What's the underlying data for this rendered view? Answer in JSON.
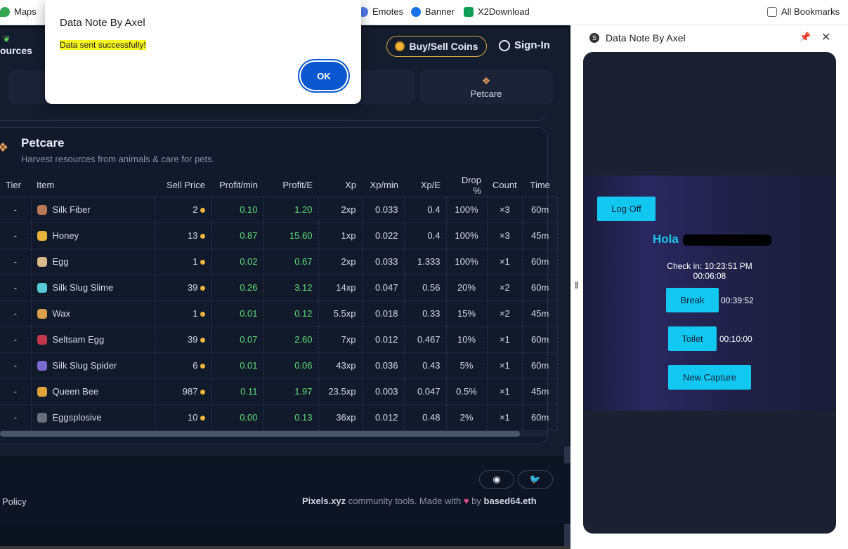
{
  "bookmarks": [
    {
      "label": "Maps",
      "color": "#34a853"
    },
    {
      "label": "Emotes",
      "color": "#4f7be8"
    },
    {
      "label": "Banner",
      "color": "#1a73e8"
    },
    {
      "label": "X2Download",
      "color": "#0f9d58"
    },
    {
      "label": "All Bookmarks",
      "color": "#5f6368"
    }
  ],
  "app": {
    "nav_label": "ources",
    "buy_sell": "Buy/Sell Coins",
    "sign_in": "Sign-In",
    "tab_label": "Petcare",
    "section_title": "Petcare",
    "section_subtitle": "Harvest resources from animals & care for pets.",
    "table": {
      "headers": [
        "Tier",
        "Item",
        "Sell Price",
        "Profit/min",
        "Profit/E",
        "Xp",
        "Xp/min",
        "Xp/E",
        "Drop %",
        "Count",
        "Time"
      ],
      "rows": [
        {
          "tier": "-",
          "item": "Silk Fiber",
          "price": "2",
          "pmin": "0.10",
          "pe": "1.20",
          "xp": "2xp",
          "xpmin": "0.033",
          "xpe": "0.4",
          "drop": "100%",
          "count": "×3",
          "time": "60m",
          "color": "#b8785a"
        },
        {
          "tier": "-",
          "item": "Honey",
          "price": "13",
          "pmin": "0.87",
          "pe": "15.60",
          "xp": "1xp",
          "xpmin": "0.022",
          "xpe": "0.4",
          "drop": "100%",
          "count": "×3",
          "time": "45m",
          "color": "#e7b33c"
        },
        {
          "tier": "-",
          "item": "Egg",
          "price": "1",
          "pmin": "0.02",
          "pe": "0.67",
          "xp": "2xp",
          "xpmin": "0.033",
          "xpe": "1.333",
          "drop": "100%",
          "count": "×1",
          "time": "60m",
          "color": "#d9b98c"
        },
        {
          "tier": "-",
          "item": "Silk Slug Slime",
          "price": "39",
          "pmin": "0.26",
          "pe": "3.12",
          "xp": "14xp",
          "xpmin": "0.047",
          "xpe": "0.56",
          "drop": "20%",
          "count": "×2",
          "time": "60m",
          "color": "#58c9d6"
        },
        {
          "tier": "-",
          "item": "Wax",
          "price": "1",
          "pmin": "0.01",
          "pe": "0.12",
          "xp": "5.5xp",
          "xpmin": "0.018",
          "xpe": "0.33",
          "drop": "15%",
          "count": "×2",
          "time": "45m",
          "color": "#d9a04a"
        },
        {
          "tier": "-",
          "item": "Seltsam Egg",
          "price": "39",
          "pmin": "0.07",
          "pe": "2.60",
          "xp": "7xp",
          "xpmin": "0.012",
          "xpe": "0.467",
          "drop": "10%",
          "count": "×1",
          "time": "60m",
          "color": "#c0364a"
        },
        {
          "tier": "-",
          "item": "Silk Slug Spider",
          "price": "6",
          "pmin": "0.01",
          "pe": "0.06",
          "xp": "43xp",
          "xpmin": "0.036",
          "xpe": "0.43",
          "drop": "5%",
          "count": "×1",
          "time": "60m",
          "color": "#7a6ad0"
        },
        {
          "tier": "-",
          "item": "Queen Bee",
          "price": "987",
          "pmin": "0.11",
          "pe": "1.97",
          "xp": "23.5xp",
          "xpmin": "0.003",
          "xpe": "0.047",
          "drop": "0.5%",
          "count": "×1",
          "time": "45m",
          "color": "#e0a33a"
        },
        {
          "tier": "-",
          "item": "Eggsplosive",
          "price": "10",
          "pmin": "0.00",
          "pe": "0.13",
          "xp": "36xp",
          "xpmin": "0.012",
          "xpe": "0.48",
          "drop": "2%",
          "count": "×1",
          "time": "60m",
          "color": "#6a6f7a"
        }
      ]
    },
    "footer": {
      "policy": "Policy",
      "brand": "Pixels.xyz",
      "text": "community tools. Made with",
      "by": "by",
      "author": "based64.eth",
      "discord": "◉",
      "twitter": "🐦"
    }
  },
  "panel": {
    "title": "Data Note By Axel",
    "logoff": "Log Off",
    "hola": "Hola",
    "checkin_line1": "Check in: 10:23:51 PM",
    "checkin_line2": "00:06:08",
    "break_label": "Break",
    "break_time": "00:39:52",
    "toilet_label": "Toilet",
    "toilet_time": "00:10:00",
    "capture_label": "New Capture"
  },
  "alert": {
    "title": "Data Note By Axel",
    "message": "Data sent successfully!",
    "ok": "OK"
  }
}
